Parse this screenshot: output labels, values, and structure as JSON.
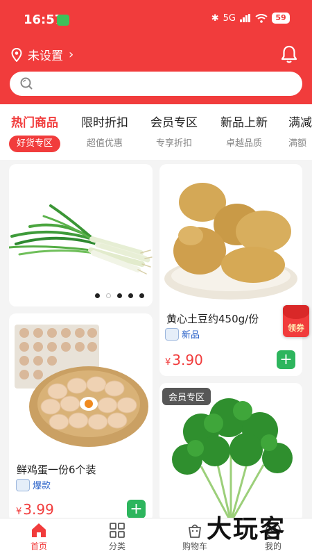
{
  "status_bar": {
    "time": "16:57",
    "network": "5G",
    "battery": "59"
  },
  "location": {
    "label": "未设置"
  },
  "search": {
    "placeholder": ""
  },
  "tabs": [
    {
      "title": "热门商品",
      "subtitle": "好货专区",
      "active": true
    },
    {
      "title": "限时折扣",
      "subtitle": "超值优惠",
      "active": false
    },
    {
      "title": "会员专区",
      "subtitle": "专享折扣",
      "active": false
    },
    {
      "title": "新品上新",
      "subtitle": "卓越品质",
      "active": false
    },
    {
      "title": "满减",
      "subtitle": "满额",
      "active": false
    }
  ],
  "banner": {
    "image": "green-onion-image",
    "slides": 5,
    "current_slide": 2
  },
  "products": [
    {
      "name": "黄心土豆约450g/份",
      "tag": "新品",
      "currency": "¥",
      "price": "3.90",
      "image": "potato-image"
    },
    {
      "name": "鲜鸡蛋一份6个装",
      "tag": "爆款",
      "currency": "¥",
      "price": "3.99",
      "image": "eggs-image"
    },
    {
      "name": "",
      "tag": "",
      "label": "会员专区",
      "image": "coriander-image"
    }
  ],
  "coupon": {
    "label": "领券"
  },
  "bottom_nav": [
    {
      "label": "首页",
      "icon": "home-icon",
      "active": true
    },
    {
      "label": "分类",
      "icon": "grid-icon",
      "active": false
    },
    {
      "label": "购物车",
      "icon": "cart-icon",
      "active": false
    },
    {
      "label": "我的",
      "icon": "user-icon",
      "active": false
    }
  ],
  "watermark": "大玩客",
  "colors": {
    "primary": "#f13c3c",
    "add_button": "#2db55d",
    "tag_text": "#2a62c9"
  }
}
